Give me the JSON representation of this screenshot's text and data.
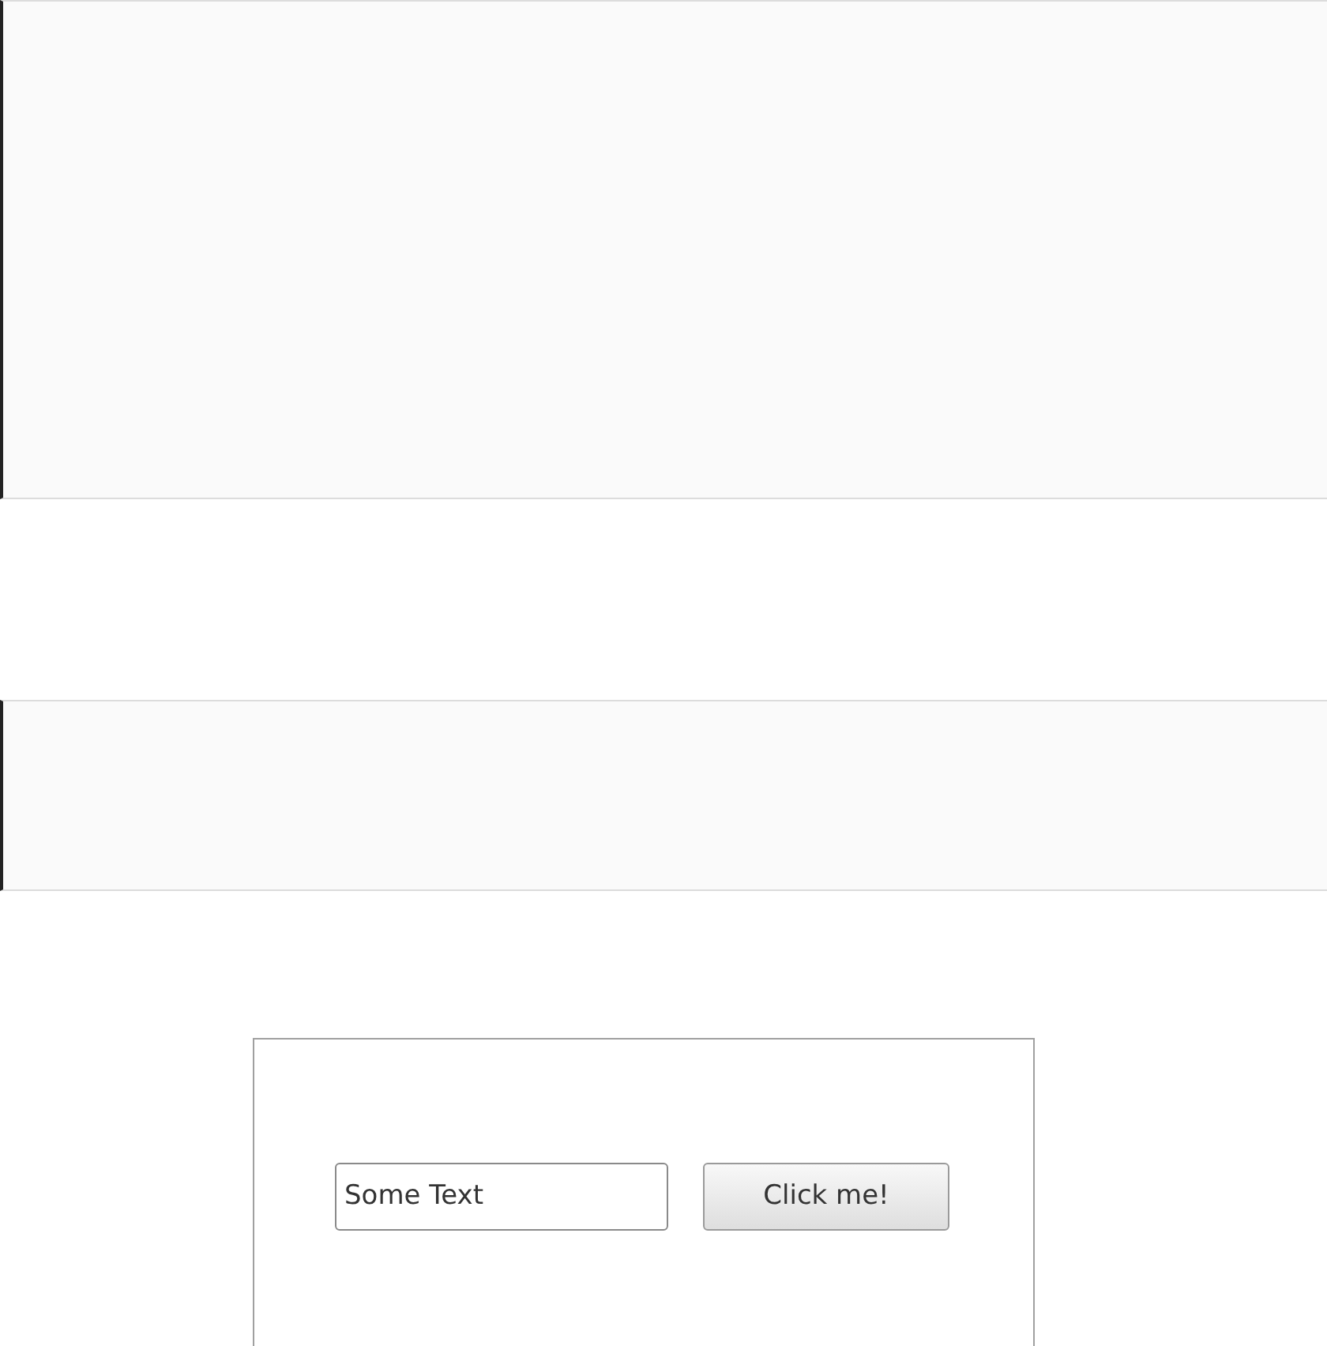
{
  "code_panels": [
    {
      "kind": "code"
    },
    {
      "kind": "code"
    }
  ],
  "demo": {
    "input": {
      "value": "Some Text"
    },
    "button": {
      "label": "Click me!"
    }
  }
}
